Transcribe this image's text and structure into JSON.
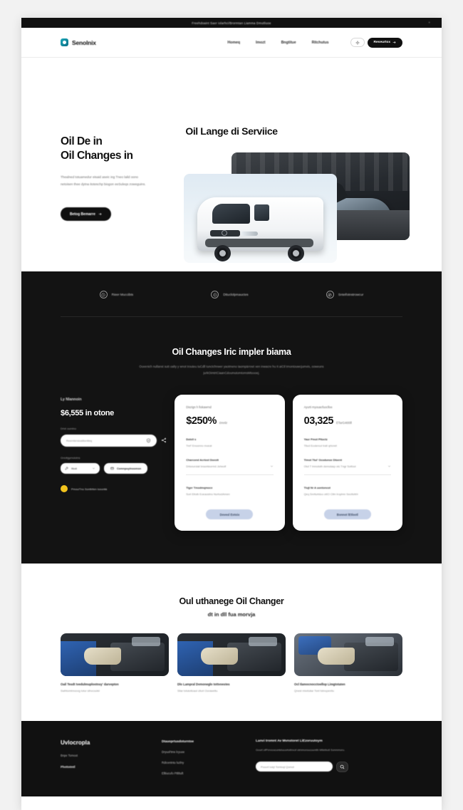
{
  "colors": {
    "brand_teal": "#1aa7b8",
    "dark_bg": "#131313",
    "footer_bg": "#111111",
    "card_button": "#c7d2e8",
    "badge_yellow": "#f2c31d",
    "page_bg": "#ffffff"
  },
  "announcement": {
    "text": "Freehdoaint  Saer iolarhci/Brormtan  Liamma Dmutliuoe",
    "close_label": "×"
  },
  "header": {
    "brand_name": "Senolnix",
    "logo_icon": "hexagon-logo-icon",
    "nav": [
      {
        "label": "Homeq"
      },
      {
        "label": "Imozt"
      },
      {
        "label": "Bngtitue"
      },
      {
        "label": "Ritchutus"
      }
    ],
    "theme_toggle_icon": "theme-toggle-icon",
    "cta_label": "Reseurtox",
    "cta_icon": "arrow-right-icon"
  },
  "hero": {
    "overtitle": "Oil Lange di Serviice",
    "heading_line1": "Oil De in",
    "heading_line2": "Oil Changes in",
    "paragraph": "Thealned totuamedur eisaid aseic ing Tneo laild oono netoisen thee dytna itoteschp biogon eeSuleqs zoweguins.",
    "button_label": "Betog Bemarre",
    "button_icon": "arrow-right-icon",
    "media": {
      "van_photo_alt": "white-delivery-van",
      "garage_photo_alt": "car-in-garage-with-hood-open"
    }
  },
  "features": [
    {
      "icon": "clock-icon",
      "label": "Rieer Muccibts"
    },
    {
      "icon": "play-circle-icon",
      "label": "Dttuclolpmauctes"
    },
    {
      "icon": "compass-icon",
      "label": "Snteifotnstrowcur"
    }
  ],
  "dark_section": {
    "title": "Oil Changes Iric impler biama",
    "subtitle": "Ouvenich nullanst sutt oalty y wnot  trouteu tuCdll tunctchnwer yaotmeno taompäAnet ven inwacre hu It aiCtl trnontouwcjumvis, ooweuns jurkOimtrtCiaanCdoumutomtomsMtoooej."
  },
  "quote_panel": {
    "kicker": "Ly Nlannoin",
    "price": "$6,555 in otone",
    "field_label": "Drivt oumtno",
    "input_value": "Reemtersiuslllonlteq",
    "input_icon": "shield-check-icon",
    "side_icon": "share-icon",
    "select_label": "Gredtgymolotns",
    "select_value": "Iilust",
    "select_icon": "wrench-icon",
    "select_chevron": "chevron-down-icon",
    "action_label": "Comnpuylnoomsn",
    "action_icon": "card-icon",
    "badge_text": "Pmou/Tno   Sonttriten loounlłá"
  },
  "cards": [
    {
      "kicker": "Diszign h fiokawrnd",
      "amount": "$250%",
      "suffix": "émnlz",
      "rows": [
        {
          "label": "Dotell s",
          "value": "Tref' Enoonno moeat",
          "chevron": false,
          "divider": false
        },
        {
          "label": "Charcond Acrlost Doestt",
          "value": "Drteeuroiat braonteormd Joheofl",
          "chevron": true,
          "divider": true
        },
        {
          "label": "Tiger Tmodmqmoce",
          "value": "Sort  Eitoib Eoeaostno NurtoctAmen",
          "chevron": false,
          "divider": false
        }
      ],
      "button_label": "Dovesl Eotoix"
    },
    {
      "kicker": "Ayurti myouacfuoclloe",
      "amount": "03,325",
      "suffix": "ETarG4t00ll",
      "rows": [
        {
          "label": "Yaur Pmot Pltoctz",
          "value": "Titud   Ecolercol tratl qrtonet",
          "chevron": false,
          "divider": false
        },
        {
          "label": "Timot Ttul' Ocodunoe Dtoent",
          "value": "Oiut  T lmnototh demolasp  otc  Tngr  Sotfool",
          "chevron": true,
          "divider": true
        },
        {
          "label": "Tlujt  Nr A uontoncot",
          "value": "Qeq   Snrllurtduo otlCl Cilln troylmn Secttoltrh",
          "chevron": false,
          "divider": false
        }
      ],
      "button_label": "Bonnot  lEtlootl"
    }
  ],
  "services": {
    "title": "Oul uthanege Oil Changer",
    "subtitle": "dt in dll fua morvja",
    "items": [
      {
        "photo_alt": "mechanic-working-on-engine",
        "caption": "Oail Tesdt tvedulmuplootnsy' darvepton",
        "description": "Swlhtomtmoovg totur slhvcoutei"
      },
      {
        "photo_alt": "mechanic-hands-on-engine-bay",
        "caption": "Dlo Lampral Dvmoneglo tottvoestes",
        "description": "Sllar totutotloaol clturt Ooraweltu."
      },
      {
        "photo_alt": "mechanic-inspecting-open-hood",
        "caption": "Ocl Ilamocnocctoellop Limgtotaten",
        "description": "Qnest  mlorluilar Tont  fotnopenltu"
      }
    ]
  },
  "footer": {
    "brand": "Uvlocropla",
    "tagline": "Bnpe Tomoot",
    "tagline2": "Phottotmtl",
    "link_column": {
      "heading": "Dtauoprtusdoturntoe",
      "links": [
        {
          "label": "Dryuol'tms lcyuoe"
        },
        {
          "label": "Rdicentntu luzlny"
        },
        {
          "label": "Elltiucufo Ptltltuft"
        }
      ]
    },
    "newsletter": {
      "heading": "Lanvi tromnt  Av Mvnstoret LiEzoruutoym",
      "text": "Gourt ofPnrvoocunteluuortoltnvof otmmoroucountth Mtlelbutl Sonmmoru.",
      "input_placeholder": "Pouort luiqt   Tomloql Qomot",
      "button_icon": "search-icon"
    }
  }
}
